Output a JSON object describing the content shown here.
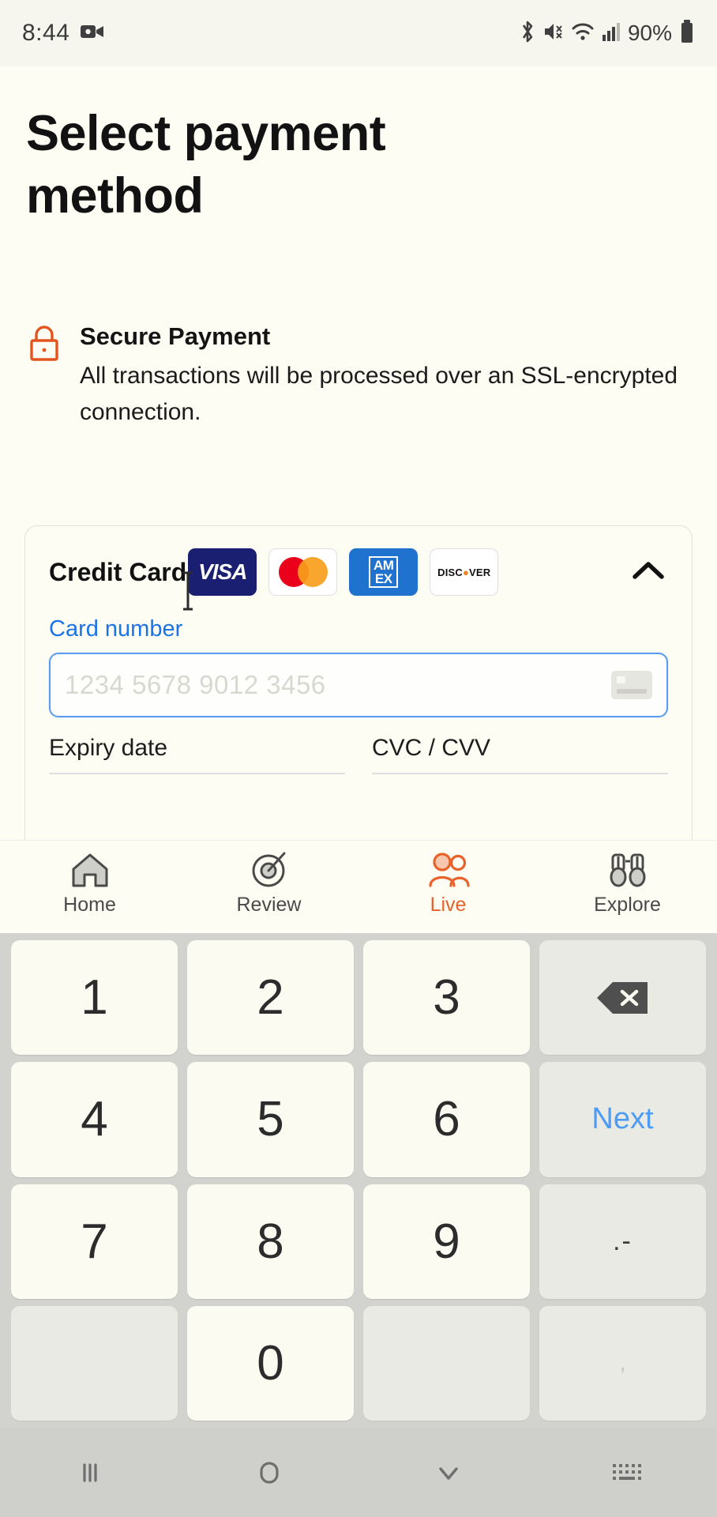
{
  "status_bar": {
    "time": "8:44",
    "battery": "90%",
    "icons": [
      "screen-record-icon",
      "bluetooth-icon",
      "mute-icon",
      "wifi-icon",
      "cellular-signal-icon",
      "battery-icon"
    ]
  },
  "page": {
    "title": "Select payment method"
  },
  "secure": {
    "icon": "lock-icon",
    "icon_color": "#e2551f",
    "title": "Secure Payment",
    "description": "All transactions will be processed over an SSL-encrypted connection."
  },
  "credit_card": {
    "title": "Credit Card",
    "collapse_icon": "chevron-up-icon",
    "brands": [
      {
        "name": "VISA",
        "id": "visa-logo",
        "bg": "#1a1f71"
      },
      {
        "name": "Mastercard",
        "id": "mastercard-logo",
        "bg": "#ffffff"
      },
      {
        "name": "AMEX",
        "id": "amex-logo",
        "bg": "#1f72cd",
        "line1": "AM",
        "line2": "EX"
      },
      {
        "name": "DISCOVER",
        "id": "discover-logo",
        "bg": "#ffffff"
      }
    ],
    "fields": {
      "card_number_label": "Card number",
      "card_number_placeholder": "1234 5678 9012 3456",
      "card_number_value": "",
      "card_number_icon": "credit-card-icon",
      "expiry_label": "Expiry date",
      "expiry_value": "",
      "cvc_label": "CVC / CVV",
      "cvc_value": ""
    },
    "accent_color": "#1a73e8"
  },
  "bottom_nav": {
    "items": [
      {
        "label": "Home",
        "icon": "home-icon",
        "active": false
      },
      {
        "label": "Review",
        "icon": "target-icon",
        "active": false
      },
      {
        "label": "Live",
        "icon": "people-icon",
        "active": true
      },
      {
        "label": "Explore",
        "icon": "binoculars-icon",
        "active": false
      }
    ],
    "active_color": "#e8622a"
  },
  "keyboard": {
    "rows": [
      [
        {
          "label": "1",
          "type": "digit"
        },
        {
          "label": "2",
          "type": "digit"
        },
        {
          "label": "3",
          "type": "digit"
        },
        {
          "label": "",
          "type": "backspace"
        }
      ],
      [
        {
          "label": "4",
          "type": "digit"
        },
        {
          "label": "5",
          "type": "digit"
        },
        {
          "label": "6",
          "type": "digit"
        },
        {
          "label": "Next",
          "type": "action"
        }
      ],
      [
        {
          "label": "7",
          "type": "digit"
        },
        {
          "label": "8",
          "type": "digit"
        },
        {
          "label": "9",
          "type": "digit"
        },
        {
          "label": ".-",
          "type": "punct"
        }
      ],
      [
        {
          "label": "",
          "type": "blank"
        },
        {
          "label": "0",
          "type": "digit"
        },
        {
          "label": "",
          "type": "blank"
        },
        {
          "label": ",",
          "type": "comma"
        }
      ]
    ],
    "next_label": "Next",
    "next_color": "#4c9bf5"
  },
  "android_nav": {
    "items": [
      "recents-icon",
      "home-circle-icon",
      "hide-keyboard-chevron-icon",
      "keyboard-switch-icon"
    ]
  }
}
